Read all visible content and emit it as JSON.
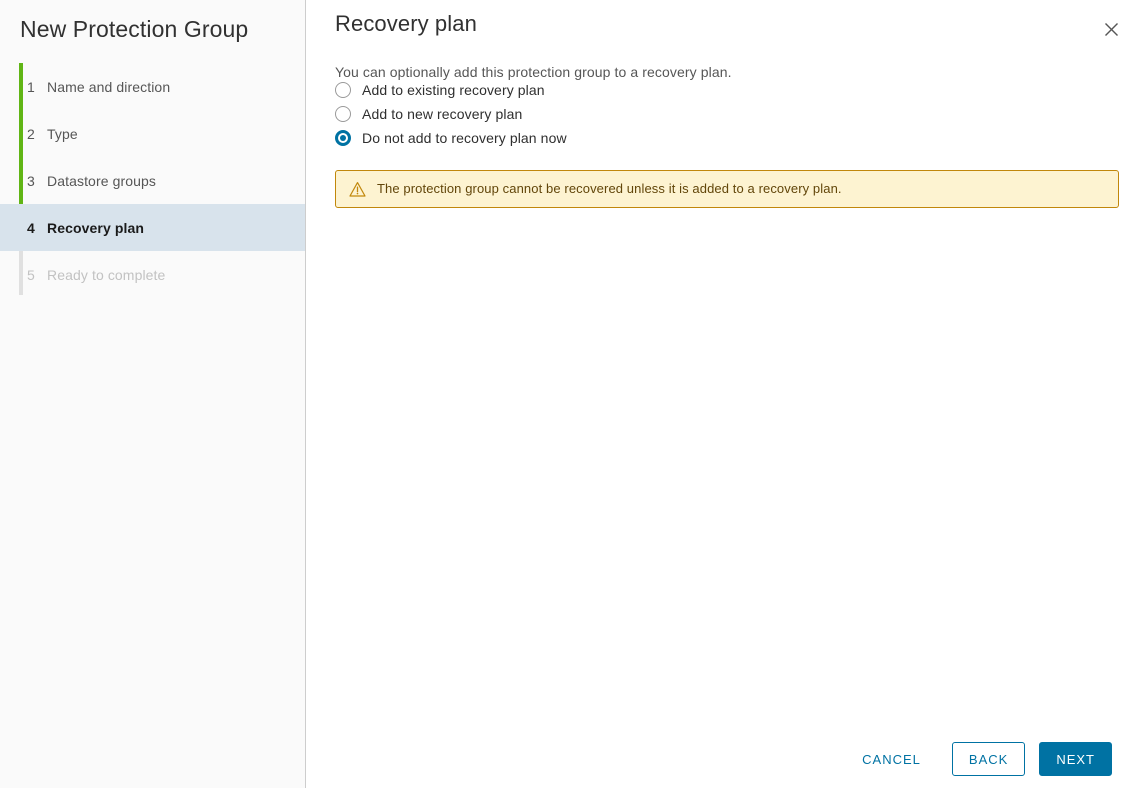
{
  "window": {
    "title": "New Protection Group",
    "close_icon": "close-icon"
  },
  "sidebar": {
    "steps": [
      {
        "number": "1",
        "label": "Name and direction",
        "state": "complete"
      },
      {
        "number": "2",
        "label": "Type",
        "state": "complete"
      },
      {
        "number": "3",
        "label": "Datastore groups",
        "state": "complete"
      },
      {
        "number": "4",
        "label": "Recovery plan",
        "state": "current"
      },
      {
        "number": "5",
        "label": "Ready to complete",
        "state": "disabled"
      }
    ],
    "progress_color": "#60b515",
    "current_highlight_color": "#d8e3ec"
  },
  "main": {
    "title": "Recovery plan",
    "description": "You can optionally add this protection group to a recovery plan.",
    "radio_group": {
      "name": "recovery-plan-option",
      "options": [
        {
          "label": "Add to existing recovery plan",
          "checked": false
        },
        {
          "label": "Add to new recovery plan",
          "checked": false
        },
        {
          "label": "Do not add to recovery plan now",
          "checked": true
        }
      ]
    },
    "alert": {
      "icon": "warning-triangle-icon",
      "severity": "warning",
      "message": "The protection group cannot be recovered unless it is added to a recovery plan.",
      "background_color": "#fdf3d1",
      "border_color": "#c1870b",
      "text_color": "#62460a"
    }
  },
  "footer": {
    "cancel_label": "CANCEL",
    "back_label": "BACK",
    "next_label": "NEXT",
    "accent_color": "#0072a3"
  }
}
